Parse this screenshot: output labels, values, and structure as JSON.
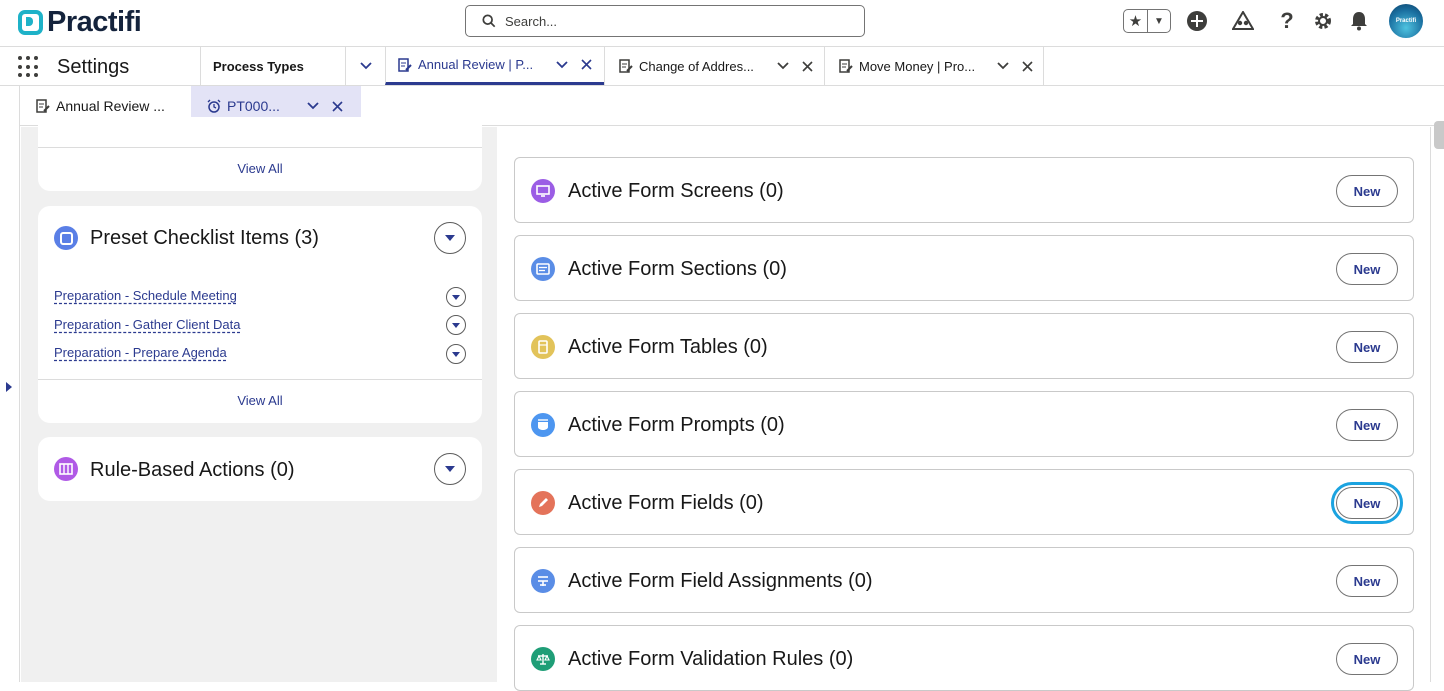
{
  "app": {
    "logo_text": "Practifi",
    "name": "Settings"
  },
  "search": {
    "placeholder": "Search..."
  },
  "header_icons": [
    "favorites-star-icon",
    "chevron-down-icon",
    "plus-icon",
    "trailhead-icon",
    "help-icon",
    "gear-icon",
    "bell-icon",
    "avatar"
  ],
  "avatar_text": "Practifi",
  "nav_tabs": [
    {
      "label": "Process Types",
      "has_dropdown": true,
      "closable": false,
      "active": false
    },
    {
      "label": "Annual Review | P...",
      "icon": "document-edit-icon",
      "active": true
    },
    {
      "label": "Change of Addres...",
      "icon": "document-edit-icon",
      "active": false
    },
    {
      "label": "Move Money | Pro...",
      "icon": "document-edit-icon",
      "active": false
    }
  ],
  "sub_tabs": [
    {
      "label": "Annual Review ...",
      "icon": "document-edit-icon",
      "active": false
    },
    {
      "label": "PT000...",
      "icon": "alarm-clock-icon",
      "active": true
    }
  ],
  "left": {
    "top_card": {
      "view_all": "View All"
    },
    "checklist": {
      "title": "Preset Checklist Items (3)",
      "items": [
        "Preparation - Schedule Meeting",
        "Preparation - Gather Client Data",
        "Preparation - Prepare Agenda"
      ],
      "view_all": "View All"
    },
    "rules": {
      "title": "Rule-Based Actions (0)"
    }
  },
  "right": {
    "cards": [
      {
        "title": "Active Form Screens (0)",
        "icon": "desktop-icon",
        "color": "#9b5de5",
        "button": "New"
      },
      {
        "title": "Active Form Sections (0)",
        "icon": "section-icon",
        "color": "#5a8de6",
        "button": "New"
      },
      {
        "title": "Active Form Tables (0)",
        "icon": "table-icon",
        "color": "#e2c35a",
        "button": "New"
      },
      {
        "title": "Active Form Prompts (0)",
        "icon": "prompt-icon",
        "color": "#4d96f0",
        "button": "New"
      },
      {
        "title": "Active Form Fields (0)",
        "icon": "pencil-icon",
        "color": "#e4735a",
        "button": "New",
        "highlighted": true
      },
      {
        "title": "Active Form Field Assignments (0)",
        "icon": "assignment-icon",
        "color": "#5a8de6",
        "button": "New"
      },
      {
        "title": "Active Form Validation Rules (0)",
        "icon": "scales-icon",
        "color": "#1f9e77",
        "button": "New"
      }
    ]
  },
  "colors": {
    "brand": "#1eb2c8",
    "link": "#2b3a8f",
    "highlight": "#1ba3e0"
  }
}
